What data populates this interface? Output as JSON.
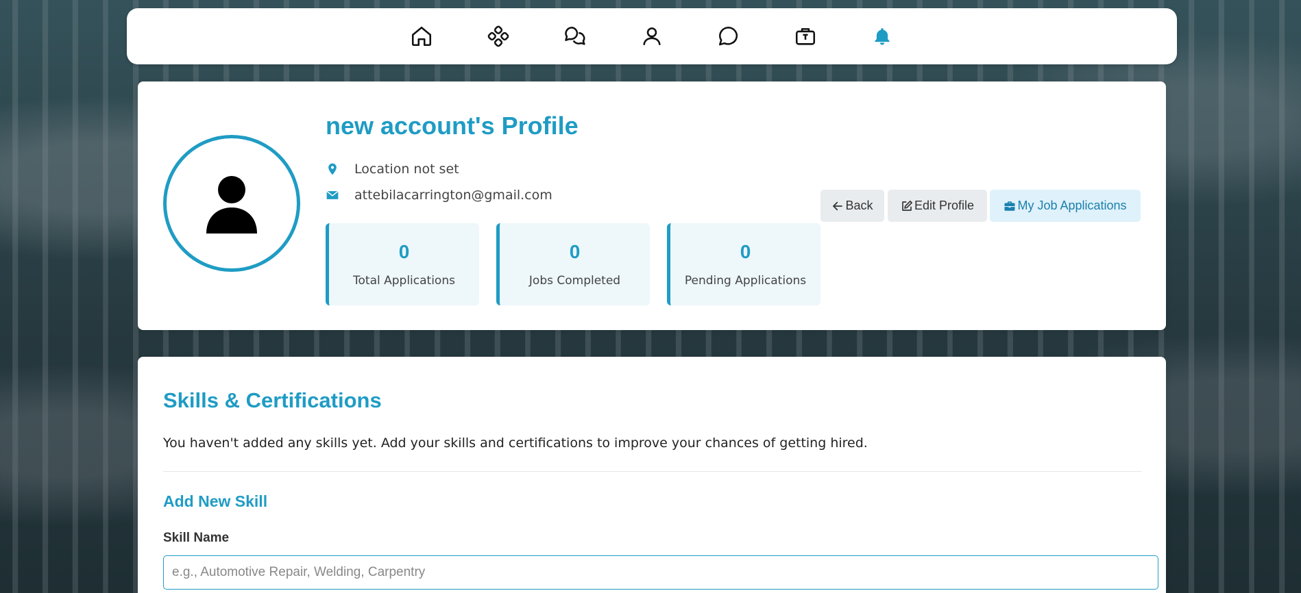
{
  "nav": {
    "icons": [
      "home-icon",
      "apps-icon",
      "messages-icon",
      "profile-icon",
      "chat-icon",
      "jobs-icon",
      "bell-icon"
    ],
    "accent_color": "#1f9cc4"
  },
  "profile": {
    "title": "new account's Profile",
    "location": "Location not set",
    "email": "attebilacarrington@gmail.com",
    "stats": [
      {
        "value": "0",
        "label": "Total Applications"
      },
      {
        "value": "0",
        "label": "Jobs Completed"
      },
      {
        "value": "0",
        "label": "Pending Applications"
      }
    ],
    "buttons": {
      "back": "Back",
      "edit": "Edit Profile",
      "applications": "My Job Applications"
    }
  },
  "skills": {
    "title": "Skills & Certifications",
    "empty_message": "You haven't added any skills yet. Add your skills and certifications to improve your chances of getting hired.",
    "add_title": "Add New Skill",
    "field_label": "Skill Name",
    "input_value": "",
    "input_placeholder": "e.g., Automotive Repair, Welding, Carpentry"
  }
}
